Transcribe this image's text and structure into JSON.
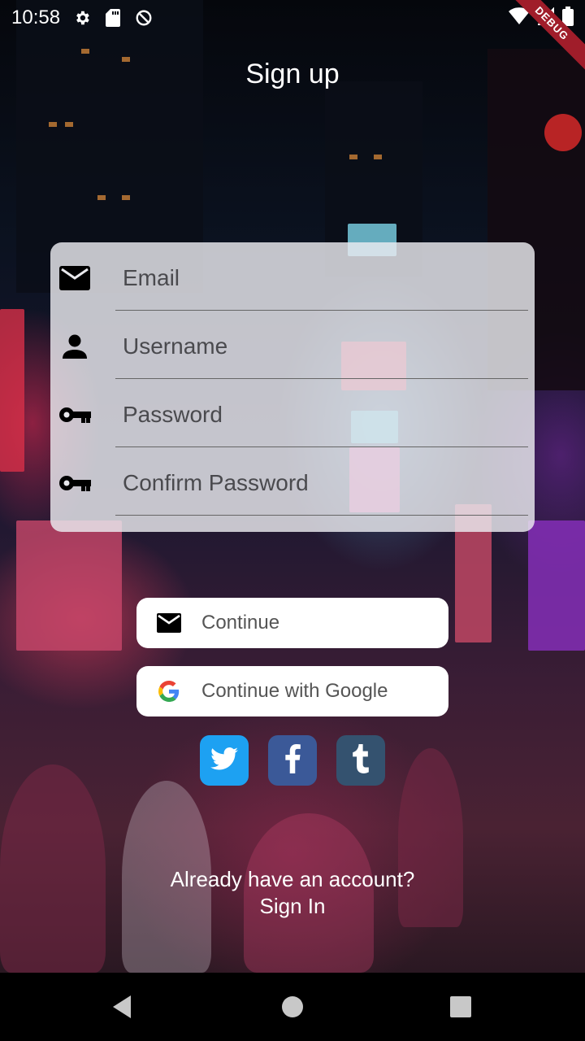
{
  "status_bar": {
    "time": "10:58",
    "icons": [
      "settings-icon",
      "sd-card-icon",
      "sync-disabled-icon",
      "wifi-icon",
      "signal-icon",
      "battery-icon"
    ]
  },
  "debug_banner": "DEBUG",
  "header": {
    "title": "Sign up"
  },
  "form": {
    "fields": [
      {
        "icon": "mail-icon",
        "placeholder": "Email"
      },
      {
        "icon": "person-icon",
        "placeholder": "Username"
      },
      {
        "icon": "key-icon",
        "placeholder": "Password"
      },
      {
        "icon": "key-icon",
        "placeholder": "Confirm Password"
      }
    ]
  },
  "buttons": {
    "continue_label": "Continue",
    "google_label": "Continue with Google"
  },
  "social": [
    {
      "name": "twitter",
      "color": "#1DA1F2"
    },
    {
      "name": "facebook",
      "color": "#3B5998"
    },
    {
      "name": "tumblr",
      "color": "#34526F"
    }
  ],
  "footer": {
    "prompt": "Already have an account?",
    "link": "Sign In"
  },
  "nav": [
    "back-icon",
    "home-icon",
    "recents-icon"
  ]
}
